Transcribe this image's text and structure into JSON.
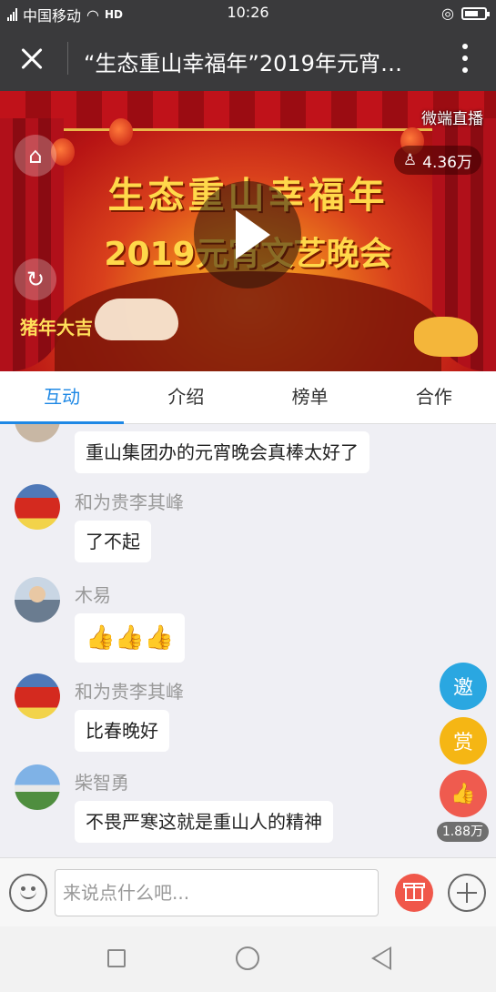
{
  "status_bar": {
    "carrier": "中国移动",
    "network": "HD",
    "time": "10:26"
  },
  "header": {
    "title": "“生态重山幸福年”2019年元宵文艺晚会",
    "close_icon": "close-icon",
    "more_icon": "more-vertical-icon"
  },
  "banner": {
    "watermark": "微端直播",
    "viewer_count": "4.36万",
    "headline_line1": "生态重山幸福年",
    "headline_line2": "2019元宵文艺晚会",
    "badge_text": "猪年大吉"
  },
  "tabs": [
    {
      "label": "互动",
      "active": true
    },
    {
      "label": "介绍",
      "active": false
    },
    {
      "label": "榜单",
      "active": false
    },
    {
      "label": "合作",
      "active": false
    }
  ],
  "messages": [
    {
      "name": "",
      "text": "重山集团办的元宵晚会真棒太好了"
    },
    {
      "name": "和为贵李其峰",
      "text": "了不起"
    },
    {
      "name": "木易",
      "text": "👍👍👍"
    },
    {
      "name": "和为贵李其峰",
      "text": "比春晚好"
    },
    {
      "name": "柴智勇",
      "text": "不畏严寒这就是重山人的精神"
    }
  ],
  "actions": {
    "invite_label": "邀",
    "reward_label": "赏",
    "like_count": "1.88万"
  },
  "input": {
    "placeholder": "来说点什么吧..."
  },
  "colors": {
    "accent_blue": "#1e88e5",
    "invite": "#2aa7e1",
    "reward": "#f5b614",
    "like": "#ef5b4f",
    "bar_dark": "#3a3a3c"
  }
}
